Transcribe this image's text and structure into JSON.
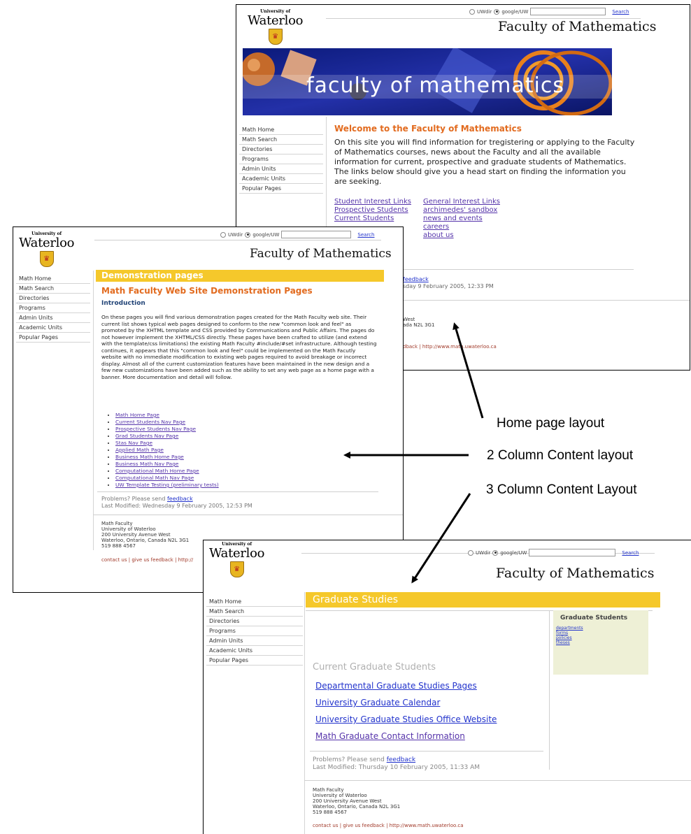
{
  "logo": {
    "university": "University of",
    "name": "Waterloo"
  },
  "search": {
    "option1": "UWdir",
    "option2": "google/UW",
    "button": "Search"
  },
  "faculty_title": "Faculty of Mathematics",
  "nav_items": [
    "Math Home",
    "Math Search",
    "Directories",
    "Programs",
    "Admin Units",
    "Academic Units",
    "Popular Pages"
  ],
  "home": {
    "banner_text": "faculty of mathematics",
    "welcome_title": "Welcome to the Faculty of Mathematics",
    "welcome_body": "On this site you will find information for tregistering or applying to the Faculty of Mathematics courses, news about the Faculty and all the available information for current, prospective and graduate students of Mathematics. The links below should give you a head start on finding the information you are seeking.",
    "student_links": [
      "Student Interest Links",
      "Prospective Students",
      "Current Students"
    ],
    "general_links": [
      "General Interest Links",
      "archimedes' sandbox",
      "news and events",
      "careers",
      "about us"
    ],
    "feedback_link": "feedback",
    "modified_partial": "sday 9 February 2005, 12:33 PM",
    "address_partial": [
      "West",
      "ada N2L 3G1"
    ],
    "footer_partial_feedback": "dback",
    "footer_partial_url": "http://www.math.uwaterloo.ca",
    "footer_sep": "|"
  },
  "two_col": {
    "band": "Demonstration pages",
    "title": "Math Faculty Web Site Demonstration Pages",
    "subtitle": "Introduction",
    "body": "On these pages you will find various demonstration pages created for the Math Faculty web site. Their current list shows typical web pages designed to conform to the new \"common look and feel\" as promoted by the XHTML template and CSS provided by Communications and Public Affairs. The pages do not however implement the XHTML/CSS directly. These pages have been crafted to utilize (and extend with the template/css limitations) the existing Math Faculty #include/#set infrastructure. Although testing continues, it appears that this \"common look and feel\" could be implemented on the Math Facutly website with no immediate modification to existing web pages required to avoid breakage or incorrect display. Almost all of the current customization features have been maintained in the new design and a few new customizations have been added such as the ability to set any web page as a home page with a banner. More documentation and detail will follow.",
    "links": [
      "Math Home Page",
      "Current Students Nav Page",
      "Prospective Students Nav Page",
      "Grad Students Nav Page",
      "Stas Nav Page",
      "Applied Math Page",
      "Business Math Home Page",
      "Business Math Nav Page",
      "Computational Math Home Page",
      "Computational Math Nav Page",
      "UW Template Testing (preliminary tests)"
    ],
    "problems": "Problems? Please send",
    "feedback_link": "feedback",
    "modified": "Last Modified:  Wednesday 9 February 2005, 12:53 PM",
    "address": [
      "Math Faculty",
      "University of Waterloo",
      "200 University Avenue West",
      "Waterloo, Ontario, Canada N2L 3G1",
      "519 888 4567"
    ],
    "footer": "contact us | give us feedback | http://"
  },
  "three_col": {
    "band": "Graduate Studies",
    "section_title": "Current Graduate Students",
    "links": [
      "Departmental Graduate Studies Pages",
      "University Graduate Calendar",
      "University Graduate Studies Office Website",
      "Math Graduate Contact Information"
    ],
    "problems": "Problems? Please send",
    "feedback_link": "feedback",
    "modified": "Last Modified:  Thursday 10 February 2005, 11:33 AM",
    "sidebar_title": "Graduate Students",
    "sidebar_links": [
      "departments",
      "forms",
      "policies",
      "theses"
    ],
    "address": [
      "Math Faculty",
      "University of Waterloo",
      "200 University Avenue West",
      "Waterloo, Ontario, Canada N2L 3G1",
      "519 888 4567"
    ],
    "footer": "contact us | give us feedback | http://www.math.uwaterloo.ca"
  },
  "captions": {
    "home": "Home page layout",
    "two_col": "2 Column Content layout",
    "three_col": "3 Column Content Layout"
  },
  "colors": {
    "band": "#f5c82b",
    "title_orange": "#e26b1f",
    "link_purple": "#5533aa"
  }
}
